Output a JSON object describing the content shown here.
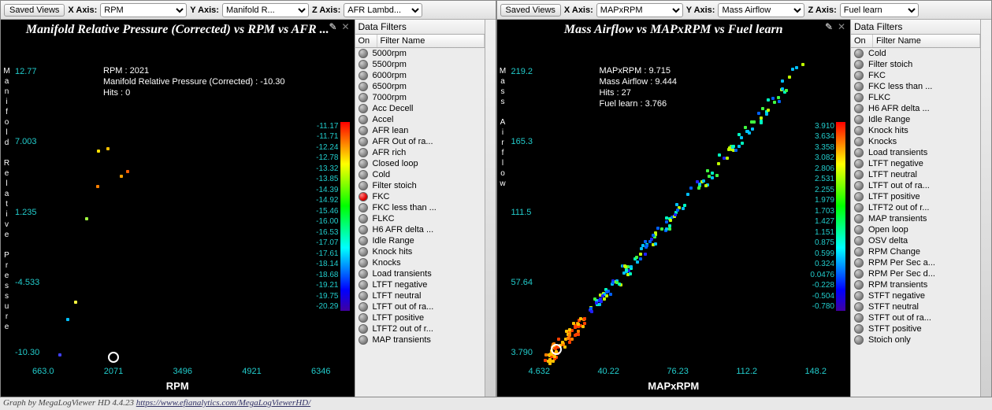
{
  "footer": {
    "text": "Graph by MegaLogViewer HD 4.4.23 ",
    "url": "https://www.efianalytics.com/MegaLogViewerHD/"
  },
  "panels": [
    {
      "toolbar": {
        "saved": "Saved Views",
        "xlabel": "X Axis:",
        "xval": "RPM",
        "ylabel": "Y Axis:",
        "yval": "Manifold R...",
        "zlabel": "Z Axis:",
        "zval": "AFR Lambd..."
      },
      "title": "Manifold Relative Pressure (Corrected) vs RPM vs AFR ...",
      "ylabel_vert": "Manifold Relative Pressure",
      "xlabel_bottom": "RPM",
      "readout": [
        "RPM : 2021",
        "Manifold Relative Pressure (Corrected) : -10.30",
        "Hits : 0"
      ],
      "xticks": [
        "663.0",
        "2071",
        "3496",
        "4921",
        "6346"
      ],
      "yticks": [
        "12.77",
        "7.003",
        "1.235",
        "-4.533",
        "-10.30"
      ],
      "cticks": [
        "-11.17",
        "-11.71",
        "-12.24",
        "-12.78",
        "-13.32",
        "-13.85",
        "-14.39",
        "-14.92",
        "-15.46",
        "-16.00",
        "-16.53",
        "-17.07",
        "-17.61",
        "-18.14",
        "-18.68",
        "-19.21",
        "-19.75",
        "-20.29"
      ],
      "chart_data": {
        "type": "scatter",
        "xlabel": "RPM",
        "ylabel": "Manifold Relative Pressure (Corrected)",
        "zlabel": "AFR Lambda",
        "xlim": [
          663,
          6346
        ],
        "ylim": [
          -10.3,
          12.77
        ],
        "cursor": {
          "x": 2071,
          "y": -10.3
        },
        "points": [
          {
            "x": 820,
            "y": -10.0,
            "c": "#4040ff"
          },
          {
            "x": 1000,
            "y": -7.2,
            "c": "#00c0ff"
          },
          {
            "x": 1180,
            "y": -5.8,
            "c": "#ffff40"
          },
          {
            "x": 1420,
            "y": 0.8,
            "c": "#a0ff40"
          },
          {
            "x": 2200,
            "y": 4.2,
            "c": "#ffa000"
          },
          {
            "x": 2350,
            "y": 4.6,
            "c": "#ff6000"
          },
          {
            "x": 1700,
            "y": 6.2,
            "c": "#ffe000"
          },
          {
            "x": 1900,
            "y": 6.4,
            "c": "#ffc000"
          },
          {
            "x": 1680,
            "y": 3.4,
            "c": "#ff8000"
          }
        ]
      },
      "filters": {
        "title": "Data Filters",
        "col_on": "On",
        "col_name": "Filter Name",
        "items": [
          {
            "name": "5000rpm",
            "on": false
          },
          {
            "name": "5500rpm",
            "on": false
          },
          {
            "name": "6000rpm",
            "on": false
          },
          {
            "name": "6500rpm",
            "on": false
          },
          {
            "name": "7000rpm",
            "on": false
          },
          {
            "name": "Acc Decell",
            "on": false
          },
          {
            "name": "Accel",
            "on": false
          },
          {
            "name": "AFR lean",
            "on": false
          },
          {
            "name": "AFR Out of ra...",
            "on": false
          },
          {
            "name": "AFR rich",
            "on": false
          },
          {
            "name": "Closed loop",
            "on": false
          },
          {
            "name": "Cold",
            "on": false
          },
          {
            "name": "Filter stoich",
            "on": false
          },
          {
            "name": "FKC",
            "on": true
          },
          {
            "name": "FKC less than ...",
            "on": false
          },
          {
            "name": "FLKC",
            "on": false
          },
          {
            "name": "H6 AFR delta ...",
            "on": false
          },
          {
            "name": "Idle Range",
            "on": false
          },
          {
            "name": "Knock hits",
            "on": false
          },
          {
            "name": "Knocks",
            "on": false
          },
          {
            "name": "Load transients",
            "on": false
          },
          {
            "name": "LTFT negative",
            "on": false
          },
          {
            "name": "LTFT neutral",
            "on": false
          },
          {
            "name": "LTFT out of ra...",
            "on": false
          },
          {
            "name": "LTFT positive",
            "on": false
          },
          {
            "name": "LTFT2 out of r...",
            "on": false
          },
          {
            "name": "MAP transients",
            "on": false
          }
        ]
      }
    },
    {
      "toolbar": {
        "saved": "Saved Views",
        "xlabel": "X Axis:",
        "xval": "MAPxRPM",
        "ylabel": "Y Axis:",
        "yval": "Mass Airflow",
        "zlabel": "Z Axis:",
        "zval": "Fuel learn"
      },
      "title": "Mass Airflow vs MAPxRPM vs Fuel learn",
      "ylabel_vert": "Mass Airflow",
      "xlabel_bottom": "MAPxRPM",
      "readout": [
        "MAPxRPM : 9.715",
        "Mass Airflow : 9.444",
        "Hits : 27",
        "Fuel learn : 3.766"
      ],
      "xticks": [
        "4.632",
        "40.22",
        "76.23",
        "112.2",
        "148.2"
      ],
      "yticks": [
        "219.2",
        "165.3",
        "111.5",
        "57.64",
        "3.790"
      ],
      "cticks": [
        "3.910",
        "3.634",
        "3.358",
        "3.082",
        "2.806",
        "2.531",
        "2.255",
        "1.979",
        "1.703",
        "1.427",
        "1.151",
        "0.875",
        "0.599",
        "0.324",
        "0.0476",
        "-0.228",
        "-0.504",
        "-0.780"
      ],
      "chart_data": {
        "type": "scatter",
        "xlabel": "MAPxRPM",
        "ylabel": "Mass Airflow",
        "zlabel": "Fuel learn",
        "xlim": [
          4.632,
          148.2
        ],
        "ylim": [
          3.79,
          219.2
        ],
        "cursor": {
          "x": 9.7,
          "y": 9.4
        },
        "diagonal_cloud": true
      },
      "filters": {
        "title": "Data Filters",
        "col_on": "On",
        "col_name": "Filter Name",
        "items": [
          {
            "name": "Cold",
            "on": false
          },
          {
            "name": "Filter stoich",
            "on": false
          },
          {
            "name": "FKC",
            "on": false
          },
          {
            "name": "FKC less than ...",
            "on": false
          },
          {
            "name": "FLKC",
            "on": false
          },
          {
            "name": "H6 AFR delta ...",
            "on": false
          },
          {
            "name": "Idle Range",
            "on": false
          },
          {
            "name": "Knock hits",
            "on": false
          },
          {
            "name": "Knocks",
            "on": false
          },
          {
            "name": "Load transients",
            "on": false
          },
          {
            "name": "LTFT negative",
            "on": false
          },
          {
            "name": "LTFT neutral",
            "on": false
          },
          {
            "name": "LTFT out of ra...",
            "on": false
          },
          {
            "name": "LTFT positive",
            "on": false
          },
          {
            "name": "LTFT2 out of r...",
            "on": false
          },
          {
            "name": "MAP transients",
            "on": false
          },
          {
            "name": "Open loop",
            "on": false
          },
          {
            "name": "OSV delta",
            "on": false
          },
          {
            "name": "RPM Change",
            "on": false
          },
          {
            "name": "RPM Per Sec a...",
            "on": false
          },
          {
            "name": "RPM Per Sec d...",
            "on": false
          },
          {
            "name": "RPM transients",
            "on": false
          },
          {
            "name": "STFT negative",
            "on": false
          },
          {
            "name": "STFT neutral",
            "on": false
          },
          {
            "name": "STFT out of ra...",
            "on": false
          },
          {
            "name": "STFT positive",
            "on": false
          },
          {
            "name": "Stoich only",
            "on": false
          }
        ]
      }
    }
  ]
}
